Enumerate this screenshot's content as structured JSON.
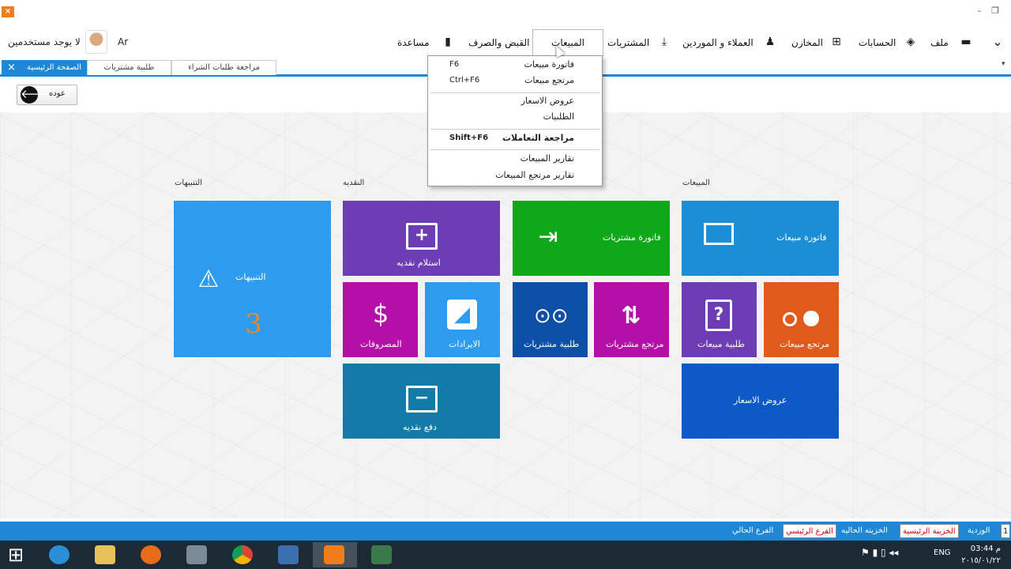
{
  "window": {
    "logo": "⨯",
    "minimize": "–",
    "restore": "❐"
  },
  "menu": {
    "items": [
      {
        "label": "ملف",
        "icon": "folder-icon"
      },
      {
        "label": "الحسابات",
        "icon": "layers-icon"
      },
      {
        "label": "المخازن",
        "icon": "monitor-plus-icon"
      },
      {
        "label": "العملاء و الموردين",
        "icon": "people-icon"
      },
      {
        "label": "المشتريات",
        "icon": "download-icon"
      },
      {
        "label": "المبيعات",
        "icon": "scissors-icon"
      },
      {
        "label": "القبض والصرف",
        "icon": "cup-icon"
      },
      {
        "label": "مساعدة",
        "icon": ""
      }
    ],
    "collapse_arrow": "⌄",
    "user_label": "لا يوجد مستخدمين",
    "language": "Ar"
  },
  "tabs": [
    {
      "label": "الصفحة الرئيسية",
      "close": "×"
    },
    {
      "label": "طلبية مشتريات"
    },
    {
      "label": "مراجعة طلبات الشراء"
    }
  ],
  "tabstrip_arrow": "▾",
  "back": {
    "label": "عوده",
    "arrow": "🡐"
  },
  "sections": {
    "alerts": "التنبيهات",
    "cash": "النقديه",
    "sales": "المبيعات"
  },
  "tiles": {
    "alerts": {
      "label": "التنبيهات",
      "count": "3",
      "color": "#2e9bef"
    },
    "cash_receive": {
      "label": "استلام نقديه",
      "color": "#6c3db5"
    },
    "purchase_invoice": {
      "label": "فاتورة مشتريات",
      "color": "#10a81b"
    },
    "sales_invoice": {
      "label": "فاتورة مبيعات",
      "color": "#1a8fd8"
    },
    "expenses": {
      "label": "المصروفات",
      "color": "#b410a8"
    },
    "revenues": {
      "label": "الايرادات",
      "color": "#2e9bef"
    },
    "purchase_order": {
      "label": "طلبية مشتريات",
      "color": "#0e4fa8"
    },
    "purchase_return": {
      "label": "مرتجع مشتريات",
      "color": "#b410a8"
    },
    "sales_order": {
      "label": "طلبية مبيعات",
      "color": "#6c3db5"
    },
    "sales_return": {
      "label": "مرتجع مبيعات",
      "color": "#e05a1c"
    },
    "cash_pay": {
      "label": "دفع نقديه",
      "color": "#147aa8"
    },
    "price_offers": {
      "label": "عروض الاسعار",
      "color": "#0e59c8"
    }
  },
  "dropdown": {
    "items": [
      {
        "label": "فاتورة مبيعات",
        "key": "F6"
      },
      {
        "label": "مرتجع مبيعات",
        "key": "Ctrl+F6"
      },
      {
        "label": "عروض الاسعار",
        "key": ""
      },
      {
        "label": "الطلبيات",
        "key": ""
      },
      {
        "label": "مراجعة التعاملات",
        "key": "Shift+F6"
      },
      {
        "label": "تقارير المبيعات",
        "key": ""
      },
      {
        "label": "تقارير مرتجع المبيعات",
        "key": ""
      }
    ]
  },
  "status": {
    "shift_num": "1",
    "shift_label": "الوردية",
    "main_treasury": "الخزينة الرئيسية",
    "current_treasury_label": "الخزينه الحاليه",
    "main_branch": "الفرع الرئيسي",
    "current_branch_label": "الفرع الحالي"
  },
  "taskbar": {
    "start": "⊞",
    "lang": "ENG",
    "time": "03:44 م",
    "date": "٢٠١٥/٠١/٢٢"
  }
}
